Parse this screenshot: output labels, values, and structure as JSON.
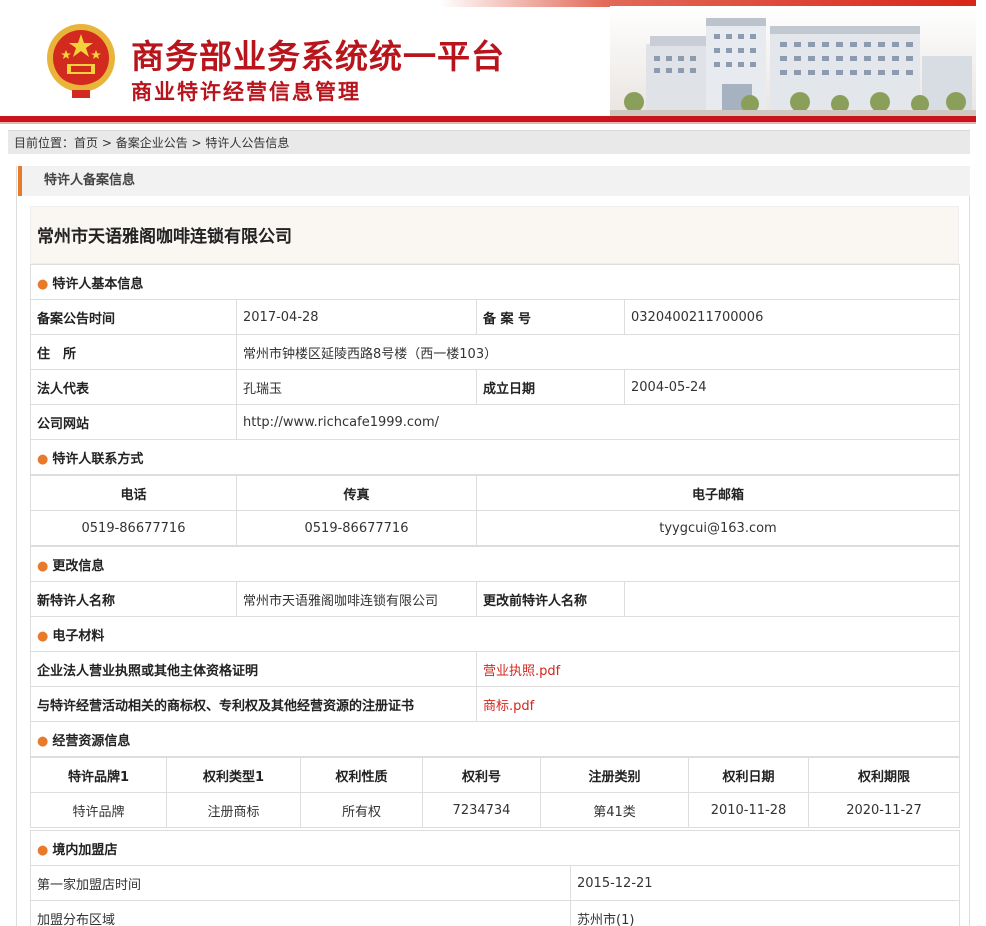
{
  "header": {
    "title": "商务部业务系统统一平台",
    "subtitle": "商业特许经营信息管理"
  },
  "breadcrumb": {
    "prefix": "目前位置：",
    "items": [
      "首页",
      "备案企业公告",
      "特许人公告信息"
    ],
    "separator": " > "
  },
  "panel": {
    "title": "特许人备案信息",
    "company_name": "常州市天语雅阁咖啡连锁有限公司"
  },
  "basic": {
    "section": "特许人基本信息",
    "record_time_label": "备案公告时间",
    "record_time": "2017-04-28",
    "record_no_label": "备 案 号",
    "record_no": "0320400211700006",
    "address_label": "住　所",
    "address": "常州市钟楼区延陵西路8号楼（西一楼103）",
    "legal_rep_label": "法人代表",
    "legal_rep": "孔瑞玉",
    "founded_label": "成立日期",
    "founded": "2004-05-24",
    "website_label": "公司网站",
    "website": "http://www.richcafe1999.com/"
  },
  "contact": {
    "section": "特许人联系方式",
    "headers": [
      "电话",
      "传真",
      "电子邮箱"
    ],
    "values": [
      "0519-86677716",
      "0519-86677716",
      "tyygcui@163.com"
    ]
  },
  "change": {
    "section": "更改信息",
    "new_name_label": "新特许人名称",
    "new_name": "常州市天语雅阁咖啡连锁有限公司",
    "old_name_label": "更改前特许人名称",
    "old_name": ""
  },
  "materials": {
    "section": "电子材料",
    "items": [
      {
        "label": "企业法人营业执照或其他主体资格证明",
        "file": "营业执照.pdf"
      },
      {
        "label": "与特许经营活动相关的商标权、专利权及其他经营资源的注册证书",
        "file": "商标.pdf"
      }
    ]
  },
  "resources": {
    "section": "经营资源信息",
    "headers": [
      "特许品牌1",
      "权利类型1",
      "权利性质",
      "权利号",
      "注册类别",
      "权利日期",
      "权利期限"
    ],
    "rows": [
      [
        "特许品牌",
        "注册商标",
        "所有权",
        "7234734",
        "第41类",
        "2010-11-28",
        "2020-11-27"
      ]
    ]
  },
  "domestic": {
    "section": "境内加盟店",
    "first_label": "第一家加盟店时间",
    "first": "2015-12-21",
    "region_label": "加盟分布区域",
    "region": "苏州市(1)"
  },
  "colors": {
    "brand_red": "#b8141c",
    "accent_orange": "#e87a2c",
    "link_red": "#d4261c"
  }
}
